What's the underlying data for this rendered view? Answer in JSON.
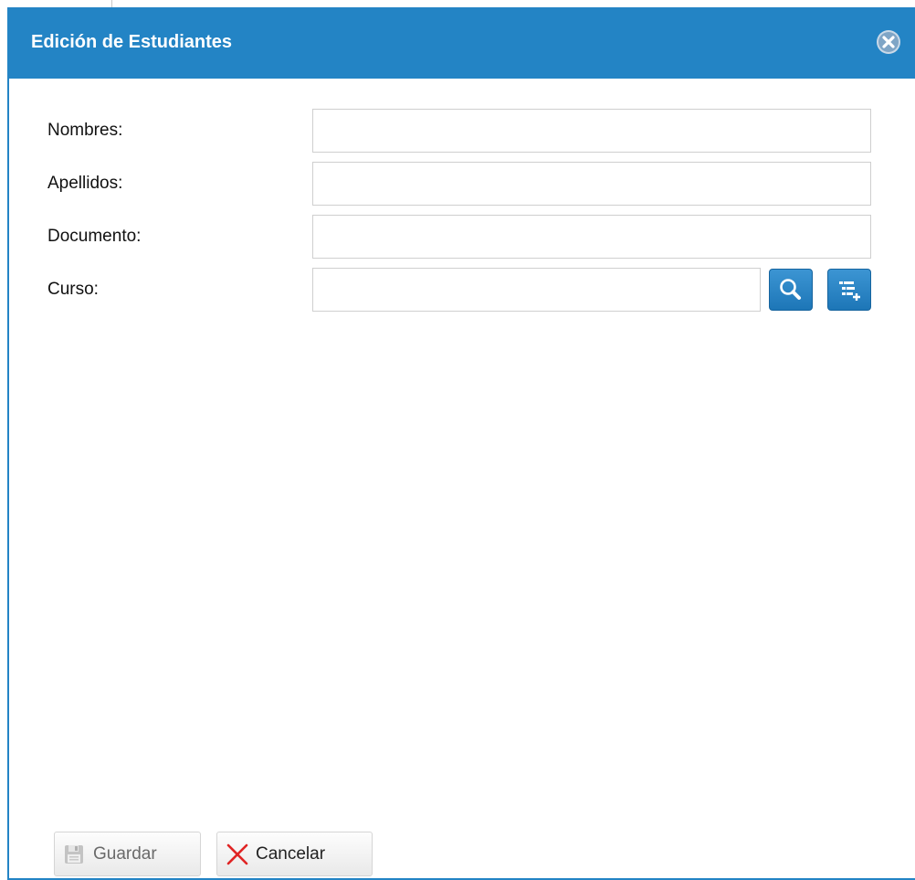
{
  "window": {
    "title": "Edición de Estudiantes",
    "close_icon": "close-circle-icon"
  },
  "form": {
    "nombres": {
      "label": "Nombres:",
      "value": "",
      "placeholder": ""
    },
    "apellidos": {
      "label": "Apellidos:",
      "value": "",
      "placeholder": ""
    },
    "documento": {
      "label": "Documento:",
      "value": "",
      "placeholder": ""
    },
    "curso": {
      "label": "Curso:",
      "value": "",
      "placeholder": "",
      "search_icon": "search-icon",
      "add_icon": "add-list-icon"
    }
  },
  "footer": {
    "save_label": "Guardar",
    "save_icon": "floppy-disk-icon",
    "save_enabled": false,
    "cancel_label": "Cancelar",
    "cancel_icon": "red-x-icon"
  },
  "colors": {
    "titlebar": "#2384c5",
    "button_accent": "#2a86c8",
    "cancel_x": "#e02424"
  }
}
